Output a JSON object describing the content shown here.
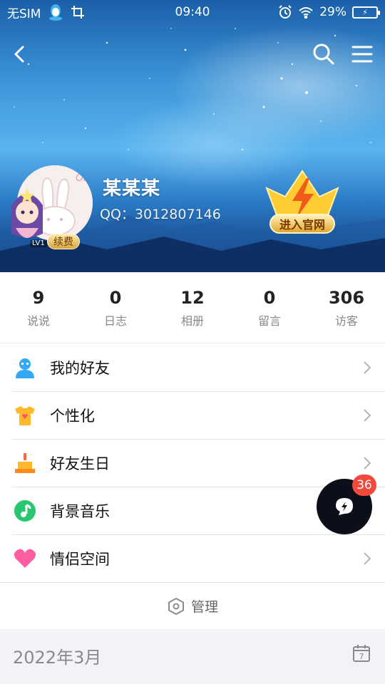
{
  "status_bar": {
    "carrier": "无SIM",
    "time": "09:40",
    "battery_percent": "29%",
    "icons": [
      "qq-penguin-icon",
      "crop-icon",
      "alarm-icon",
      "wifi-icon",
      "battery-icon"
    ]
  },
  "nav": {
    "back_icon": "chevron-left-icon",
    "search_icon": "search-icon",
    "menu_icon": "hamburger-menu-icon"
  },
  "profile": {
    "name": "某某某",
    "qq": "QQ：3012807146",
    "level_badge": "LV1",
    "renew_label": "续费",
    "vip_entry_label": "进入官网"
  },
  "stats": [
    {
      "value": "9",
      "label": "说说"
    },
    {
      "value": "0",
      "label": "日志"
    },
    {
      "value": "12",
      "label": "相册"
    },
    {
      "value": "0",
      "label": "留言"
    },
    {
      "value": "306",
      "label": "访客"
    }
  ],
  "menu": [
    {
      "label": "我的好友",
      "icon": "friend-icon",
      "color": "#35a8f5"
    },
    {
      "label": "个性化",
      "icon": "tshirt-icon",
      "color": "#ffb92a"
    },
    {
      "label": "好友生日",
      "icon": "birthday-cake-icon",
      "color": "#ff9f1a"
    },
    {
      "label": "背景音乐",
      "icon": "music-note-icon",
      "color": "#28c76f"
    },
    {
      "label": "情侣空间",
      "icon": "heart-icon",
      "color": "#ff5fa2"
    }
  ],
  "manage": {
    "label": "管理",
    "icon": "hexagon-gear-icon"
  },
  "date_bar": {
    "label": "2022年3月",
    "icon": "calendar-icon",
    "calendar_day": "7"
  },
  "floating": {
    "badge": "36",
    "icon": "lightning-bubble-icon"
  }
}
